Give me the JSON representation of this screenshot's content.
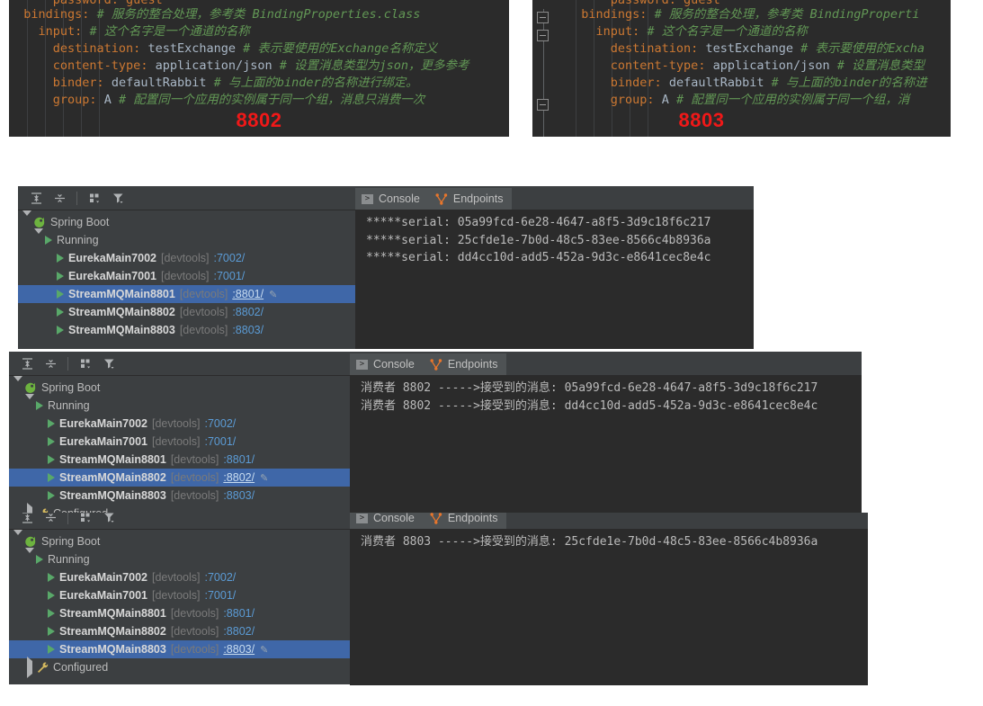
{
  "code_panels": [
    {
      "name": "yaml-config-8802",
      "port_label": "8802",
      "lines": [
        [
          {
            "t": "      ",
            "c": "v"
          },
          {
            "t": "password: guest",
            "c": "k"
          }
        ],
        [
          {
            "t": "  ",
            "c": "v"
          },
          {
            "t": "bindings:",
            "c": "k"
          },
          {
            "t": " ",
            "c": "v"
          },
          {
            "t": "# 服务的整合处理，参考类 BindingProperties.class",
            "c": "cm"
          }
        ],
        [
          {
            "t": "    ",
            "c": "v"
          },
          {
            "t": "input:",
            "c": "k"
          },
          {
            "t": " ",
            "c": "v"
          },
          {
            "t": "# 这个名字是一个通道的名称",
            "c": "cm"
          }
        ],
        [
          {
            "t": "      ",
            "c": "v"
          },
          {
            "t": "destination:",
            "c": "k"
          },
          {
            "t": " testExchange ",
            "c": "v"
          },
          {
            "t": "# 表示要使用的Exchange名称定义",
            "c": "cm"
          }
        ],
        [
          {
            "t": "      ",
            "c": "v"
          },
          {
            "t": "content-type:",
            "c": "k"
          },
          {
            "t": " application/json ",
            "c": "v"
          },
          {
            "t": "# 设置消息类型为json，更多参考",
            "c": "cm"
          }
        ],
        [
          {
            "t": "      ",
            "c": "v"
          },
          {
            "t": "binder:",
            "c": "k"
          },
          {
            "t": " defaultRabbit ",
            "c": "v"
          },
          {
            "t": "# 与上面的binder的名称进行绑定。",
            "c": "cm"
          }
        ],
        [
          {
            "t": "      ",
            "c": "v"
          },
          {
            "t": "group:",
            "c": "k"
          },
          {
            "t": " A ",
            "c": "v"
          },
          {
            "t": "# 配置同一个应用的实例属于同一个组，消息只消费一次",
            "c": "cm"
          }
        ]
      ]
    },
    {
      "name": "yaml-config-8803",
      "port_label": "8803",
      "lines": [
        [
          {
            "t": "      ",
            "c": "v"
          },
          {
            "t": "password: guest",
            "c": "k"
          }
        ],
        [
          {
            "t": "  ",
            "c": "v"
          },
          {
            "t": "bindings:",
            "c": "k"
          },
          {
            "t": " ",
            "c": "v"
          },
          {
            "t": "# 服务的整合处理，参考类 BindingProperti",
            "c": "cm"
          }
        ],
        [
          {
            "t": "    ",
            "c": "v"
          },
          {
            "t": "input:",
            "c": "k"
          },
          {
            "t": " ",
            "c": "v"
          },
          {
            "t": "# 这个名字是一个通道的名称",
            "c": "cm"
          }
        ],
        [
          {
            "t": "      ",
            "c": "v"
          },
          {
            "t": "destination:",
            "c": "k"
          },
          {
            "t": " testExchange ",
            "c": "v"
          },
          {
            "t": "# 表示要使用的Excha",
            "c": "cm"
          }
        ],
        [
          {
            "t": "      ",
            "c": "v"
          },
          {
            "t": "content-type:",
            "c": "k"
          },
          {
            "t": " application/json ",
            "c": "v"
          },
          {
            "t": "# 设置消息类型",
            "c": "cm"
          }
        ],
        [
          {
            "t": "      ",
            "c": "v"
          },
          {
            "t": "binder:",
            "c": "k"
          },
          {
            "t": " defaultRabbit ",
            "c": "v"
          },
          {
            "t": "# 与上面的binder的名称进",
            "c": "cm"
          }
        ],
        [
          {
            "t": "      ",
            "c": "v"
          },
          {
            "t": "group:",
            "c": "k"
          },
          {
            "t": " A ",
            "c": "v"
          },
          {
            "t": "# 配置同一个应用的实例属于同一个组，消",
            "c": "cm"
          }
        ]
      ]
    }
  ],
  "toolbar": {
    "expand_all": "Expand All",
    "collapse_all": "Collapse All",
    "group_by": "Group By",
    "filter": "Filter"
  },
  "console_tabs": {
    "console": "Console",
    "endpoints": "Endpoints"
  },
  "sections": [
    {
      "name": "services-8801",
      "tree": {
        "root": "Spring Boot",
        "group": "Running",
        "selected_index": 2,
        "items": [
          {
            "name": "EurekaMain7002",
            "tag": "[devtools]",
            "port": ":7002/"
          },
          {
            "name": "EurekaMain7001",
            "tag": "[devtools]",
            "port": ":7001/"
          },
          {
            "name": "StreamMQMain8801",
            "tag": "[devtools]",
            "port": ":8801/"
          },
          {
            "name": "StreamMQMain8802",
            "tag": "[devtools]",
            "port": ":8802/"
          },
          {
            "name": "StreamMQMain8803",
            "tag": "[devtools]",
            "port": ":8803/"
          }
        ],
        "configured": ""
      },
      "console_lines": [
        "*****serial: 05a99fcd-6e28-4647-a8f5-3d9c18f6c217",
        "*****serial: 25cfde1e-7b0d-48c5-83ee-8566c4b8936a",
        "*****serial: dd4cc10d-add5-452a-9d3c-e8641cec8e4c"
      ]
    },
    {
      "name": "services-8802",
      "tree": {
        "root": "Spring Boot",
        "group": "Running",
        "selected_index": 3,
        "items": [
          {
            "name": "EurekaMain7002",
            "tag": "[devtools]",
            "port": ":7002/"
          },
          {
            "name": "EurekaMain7001",
            "tag": "[devtools]",
            "port": ":7001/"
          },
          {
            "name": "StreamMQMain8801",
            "tag": "[devtools]",
            "port": ":8801/"
          },
          {
            "name": "StreamMQMain8802",
            "tag": "[devtools]",
            "port": ":8802/"
          },
          {
            "name": "StreamMQMain8803",
            "tag": "[devtools]",
            "port": ":8803/"
          }
        ],
        "configured": "Configured"
      },
      "console_lines": [
        "消费者 8802 ----->接受到的消息: 05a99fcd-6e28-4647-a8f5-3d9c18f6c217",
        "消费者 8802 ----->接受到的消息: dd4cc10d-add5-452a-9d3c-e8641cec8e4c"
      ]
    },
    {
      "name": "services-8803",
      "tree": {
        "root": "Spring Boot",
        "group": "Running",
        "selected_index": 4,
        "items": [
          {
            "name": "EurekaMain7002",
            "tag": "[devtools]",
            "port": ":7002/"
          },
          {
            "name": "EurekaMain7001",
            "tag": "[devtools]",
            "port": ":7001/"
          },
          {
            "name": "StreamMQMain8801",
            "tag": "[devtools]",
            "port": ":8801/"
          },
          {
            "name": "StreamMQMain8802",
            "tag": "[devtools]",
            "port": ":8802/"
          },
          {
            "name": "StreamMQMain8803",
            "tag": "[devtools]",
            "port": ":8803/"
          }
        ],
        "configured": "Configured"
      },
      "console_lines": [
        "消费者 8803 ----->接受到的消息: 25cfde1e-7b0d-48c5-83ee-8566c4b8936a"
      ]
    }
  ],
  "colors": {
    "editor_bg": "#2b2b2b",
    "panel_bg": "#3c3f41",
    "selection": "#3f67a8",
    "accent_red": "#f01818",
    "green_run": "#59a869",
    "comment_green": "#629755",
    "key_orange": "#cc7832",
    "port_blue": "#5b9bd5"
  }
}
